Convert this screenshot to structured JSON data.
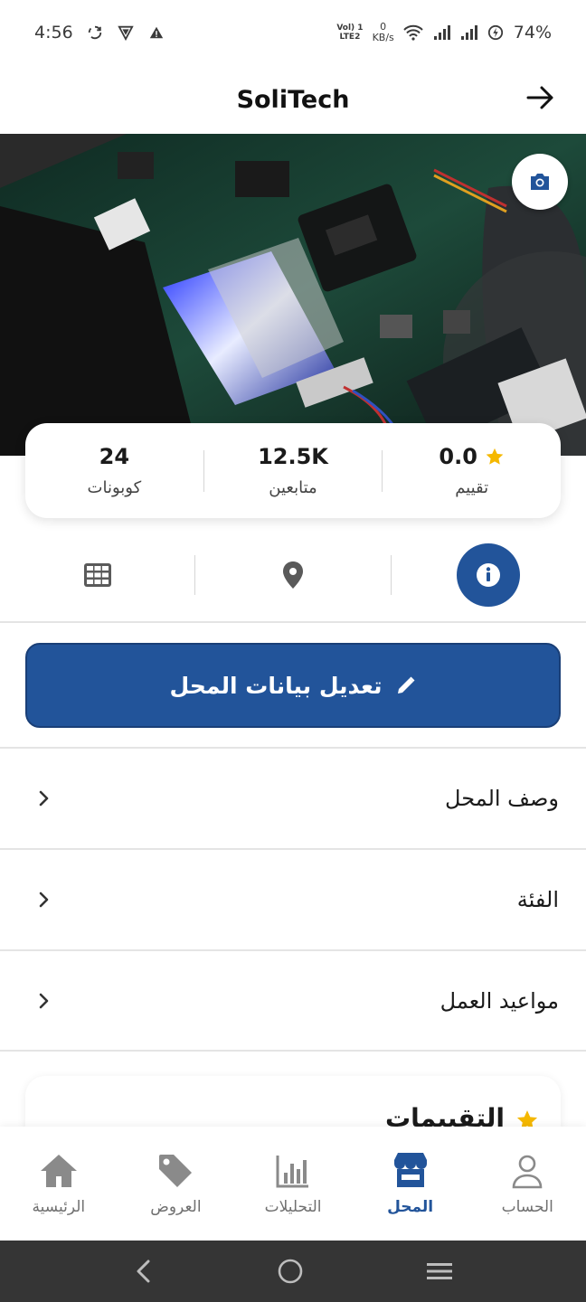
{
  "status_bar": {
    "time": "4:56",
    "network_top": "Vol) 1",
    "network_bottom": "LTE2",
    "speed_value": "0",
    "speed_unit": "KB/s",
    "battery": "74%"
  },
  "header": {
    "title": "SoliTech"
  },
  "stats": [
    {
      "value": "0.0",
      "label": "تقييم",
      "icon": "star-icon"
    },
    {
      "value": "12.5K",
      "label": "متابعين"
    },
    {
      "value": "24",
      "label": "كوبونات"
    }
  ],
  "tabs": [
    {
      "icon": "info-icon",
      "active": true
    },
    {
      "icon": "location-pin-icon",
      "active": false
    },
    {
      "icon": "grid-icon",
      "active": false
    }
  ],
  "edit_button": {
    "label": "تعديل بيانات المحل",
    "icon": "pencil-icon"
  },
  "list": [
    {
      "label": "وصف المحل"
    },
    {
      "label": "الفئة"
    },
    {
      "label": "مواعيد العمل"
    }
  ],
  "ratings": {
    "title": "التقييمات"
  },
  "bottom_nav": [
    {
      "label": "الحساب",
      "icon": "person-icon",
      "active": false
    },
    {
      "label": "المحل",
      "icon": "store-icon",
      "active": true
    },
    {
      "label": "التحليلات",
      "icon": "chart-icon",
      "active": false
    },
    {
      "label": "العروض",
      "icon": "tag-icon",
      "active": false
    },
    {
      "label": "الرئيسية",
      "icon": "home-icon",
      "active": false
    }
  ],
  "colors": {
    "primary": "#22549a",
    "star": "#f5b800",
    "text": "#1a1a1a",
    "muted": "#707070"
  }
}
